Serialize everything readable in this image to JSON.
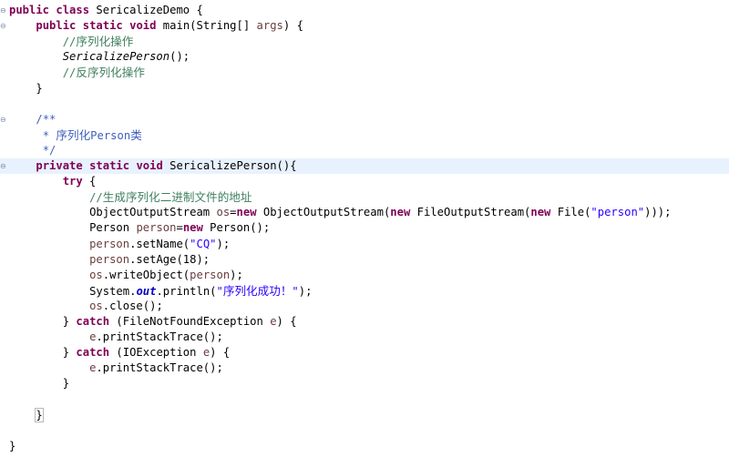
{
  "editor": {
    "lines": [
      {
        "indent": "",
        "tokens": [
          {
            "t": "public",
            "c": "kw"
          },
          {
            "t": " "
          },
          {
            "t": "class",
            "c": "kw"
          },
          {
            "t": " SericalizeDemo {"
          }
        ]
      },
      {
        "indent": "    ",
        "tokens": [
          {
            "t": "public",
            "c": "kw"
          },
          {
            "t": " "
          },
          {
            "t": "static",
            "c": "kw"
          },
          {
            "t": " "
          },
          {
            "t": "void",
            "c": "kw"
          },
          {
            "t": " main(String[] "
          },
          {
            "t": "args",
            "c": "vr"
          },
          {
            "t": ") {"
          }
        ]
      },
      {
        "indent": "        ",
        "tokens": [
          {
            "t": "//",
            "c": "cmm"
          },
          {
            "t": "序列化操作",
            "c": "cm"
          }
        ]
      },
      {
        "indent": "        ",
        "tokens": [
          {
            "t": "SericalizePerson",
            "c": "it"
          },
          {
            "t": "();"
          }
        ]
      },
      {
        "indent": "        ",
        "tokens": [
          {
            "t": "//",
            "c": "cmm"
          },
          {
            "t": "反序列化操作",
            "c": "cm"
          }
        ]
      },
      {
        "indent": "    ",
        "tokens": [
          {
            "t": "}"
          }
        ]
      },
      {
        "indent": "",
        "tokens": []
      },
      {
        "indent": "    ",
        "tokens": [
          {
            "t": "/**",
            "c": "jd"
          }
        ]
      },
      {
        "indent": "     ",
        "tokens": [
          {
            "t": "* ",
            "c": "jd"
          },
          {
            "t": "序列化",
            "c": "jdc"
          },
          {
            "t": "Person",
            "c": "jd"
          },
          {
            "t": "类",
            "c": "jdc"
          }
        ]
      },
      {
        "indent": "     ",
        "tokens": [
          {
            "t": "*/",
            "c": "jd"
          }
        ]
      },
      {
        "indent": "    ",
        "tokens": [
          {
            "t": "private",
            "c": "kw"
          },
          {
            "t": " "
          },
          {
            "t": "static",
            "c": "kw"
          },
          {
            "t": " "
          },
          {
            "t": "void",
            "c": "kw"
          },
          {
            "t": " SericalizePerson(){"
          }
        ]
      },
      {
        "indent": "        ",
        "tokens": [
          {
            "t": "try",
            "c": "kw"
          },
          {
            "t": " {"
          }
        ]
      },
      {
        "indent": "            ",
        "tokens": [
          {
            "t": "//",
            "c": "cmm"
          },
          {
            "t": "生成序列化二进制文件的地址",
            "c": "cm"
          }
        ]
      },
      {
        "indent": "            ",
        "tokens": [
          {
            "t": "ObjectOutputStream "
          },
          {
            "t": "os",
            "c": "vr"
          },
          {
            "t": "="
          },
          {
            "t": "new",
            "c": "kw"
          },
          {
            "t": " ObjectOutputStream("
          },
          {
            "t": "new",
            "c": "kw"
          },
          {
            "t": " FileOutputStream("
          },
          {
            "t": "new",
            "c": "kw"
          },
          {
            "t": " File("
          },
          {
            "t": "\"person\"",
            "c": "st"
          },
          {
            "t": ")));"
          }
        ]
      },
      {
        "indent": "            ",
        "tokens": [
          {
            "t": "Person "
          },
          {
            "t": "person",
            "c": "vr"
          },
          {
            "t": "="
          },
          {
            "t": "new",
            "c": "kw"
          },
          {
            "t": " Person();"
          }
        ]
      },
      {
        "indent": "            ",
        "tokens": [
          {
            "t": "person",
            "c": "vr"
          },
          {
            "t": ".setName("
          },
          {
            "t": "\"CQ\"",
            "c": "st"
          },
          {
            "t": ");"
          }
        ]
      },
      {
        "indent": "            ",
        "tokens": [
          {
            "t": "person",
            "c": "vr"
          },
          {
            "t": ".setAge(18);"
          }
        ]
      },
      {
        "indent": "            ",
        "tokens": [
          {
            "t": "os",
            "c": "vr"
          },
          {
            "t": ".writeObject("
          },
          {
            "t": "person",
            "c": "vr"
          },
          {
            "t": ");"
          }
        ]
      },
      {
        "indent": "            ",
        "tokens": [
          {
            "t": "System."
          },
          {
            "t": "out",
            "c": "fd"
          },
          {
            "t": ".println("
          },
          {
            "t": "\"",
            "c": "st"
          },
          {
            "t": "序列化成功！",
            "c": "stc"
          },
          {
            "t": "\"",
            "c": "st"
          },
          {
            "t": ");"
          }
        ]
      },
      {
        "indent": "            ",
        "tokens": [
          {
            "t": "os",
            "c": "vr"
          },
          {
            "t": ".close();"
          }
        ]
      },
      {
        "indent": "        ",
        "tokens": [
          {
            "t": "} "
          },
          {
            "t": "catch",
            "c": "kw"
          },
          {
            "t": " (FileNotFoundException "
          },
          {
            "t": "e",
            "c": "vr"
          },
          {
            "t": ") {"
          }
        ]
      },
      {
        "indent": "            ",
        "tokens": [
          {
            "t": "e",
            "c": "vr"
          },
          {
            "t": ".printStackTrace();"
          }
        ]
      },
      {
        "indent": "        ",
        "tokens": [
          {
            "t": "} "
          },
          {
            "t": "catch",
            "c": "kw"
          },
          {
            "t": " (IOException "
          },
          {
            "t": "e",
            "c": "vr"
          },
          {
            "t": ") {"
          }
        ]
      },
      {
        "indent": "            ",
        "tokens": [
          {
            "t": "e",
            "c": "vr"
          },
          {
            "t": ".printStackTrace();"
          }
        ]
      },
      {
        "indent": "        ",
        "tokens": [
          {
            "t": "}"
          }
        ]
      },
      {
        "indent": "",
        "tokens": []
      },
      {
        "indent": "    ",
        "tokens": [
          {
            "t": "}",
            "c": "box"
          }
        ]
      },
      {
        "indent": "",
        "tokens": []
      },
      {
        "indent": "}",
        "tokens": []
      }
    ],
    "current_line_index": 10,
    "fold_marker_lines": [
      0,
      1,
      7,
      10
    ],
    "fold_icon": "collapse-minus-icon",
    "colors": {
      "keyword": "#7f0055",
      "comment": "#3f7f5f",
      "javadoc": "#3f5fbf",
      "string": "#2a00ff",
      "local_variable": "#6a3e3e",
      "static_field": "#0000c0",
      "current_line": "#e8f2fe"
    }
  }
}
